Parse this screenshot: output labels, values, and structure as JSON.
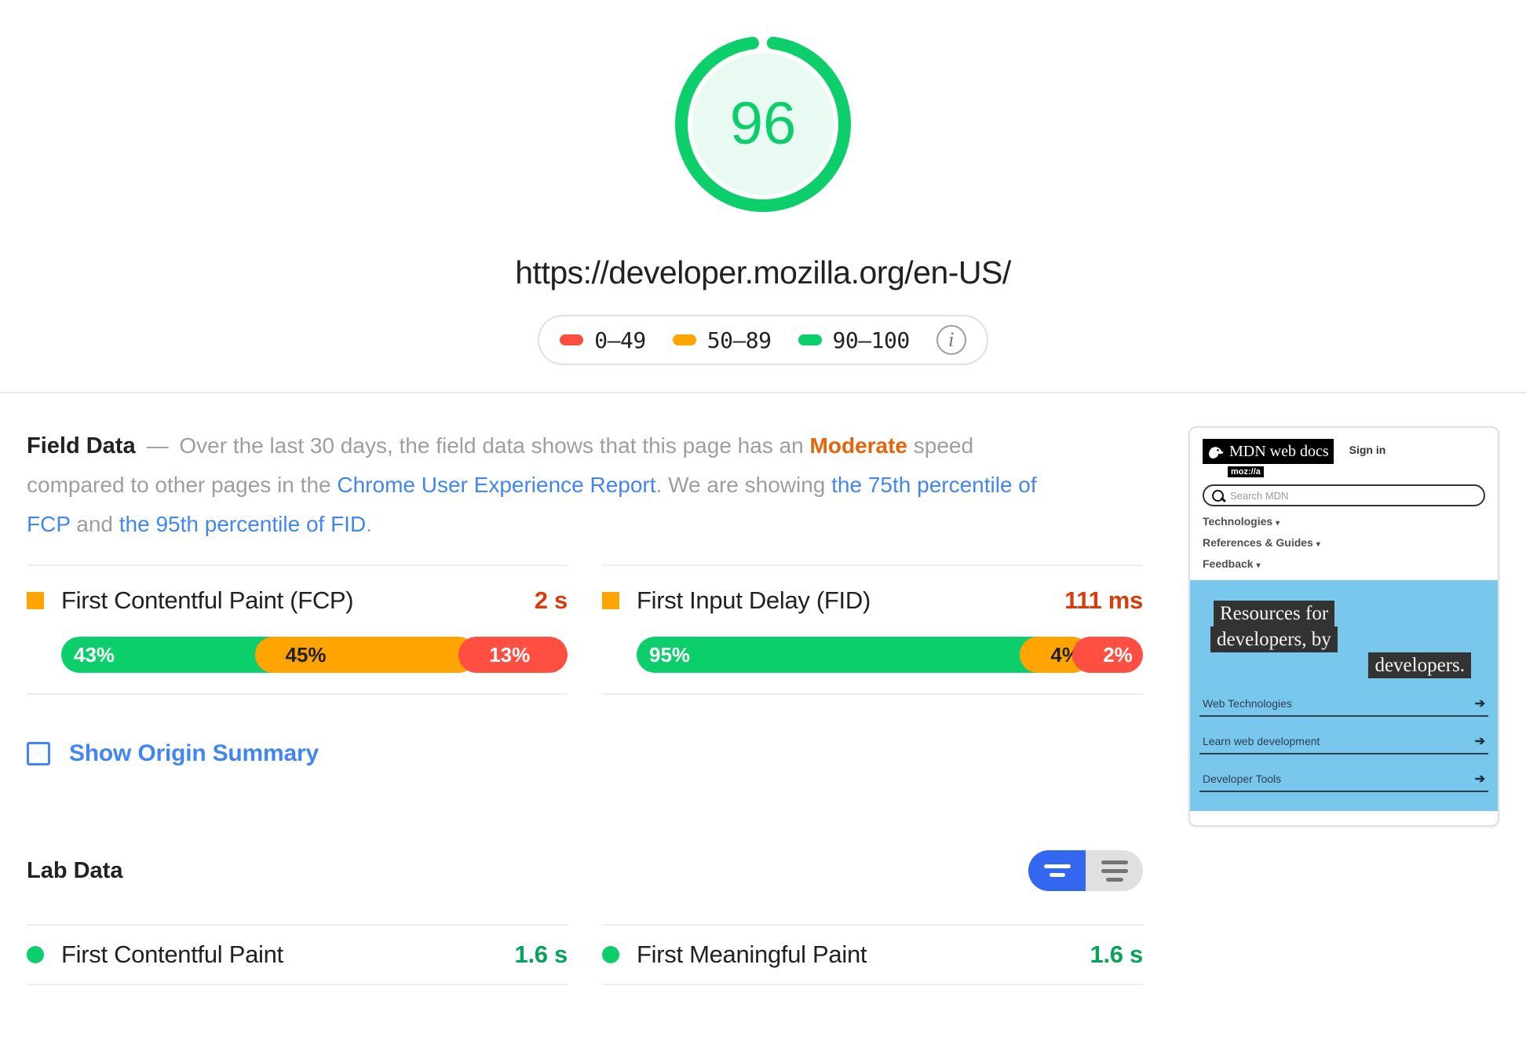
{
  "score": {
    "value": "96",
    "color": "#0cce6b",
    "url": "https://developer.mozilla.org/en-US/"
  },
  "legend": {
    "items": [
      {
        "label": "0–49",
        "color": "#ff4e42",
        "name": "poor"
      },
      {
        "label": "50–89",
        "color": "#ffa400",
        "name": "average"
      },
      {
        "label": "90–100",
        "color": "#0cce6b",
        "name": "good"
      }
    ],
    "info_icon": "i"
  },
  "field_data": {
    "title": "Field Data",
    "dash": "—",
    "text_1": "Over the last 30 days, the field data shows that this page has an ",
    "rating": "Moderate",
    "text_2": " speed compared to other pages in the ",
    "link_1": "Chrome User Experience Report",
    "text_3": ". We are showing ",
    "link_2": "the 75th percentile of FCP",
    "text_4": " and ",
    "link_3": "the 95th percentile of FID",
    "text_5": ".",
    "metrics": [
      {
        "name": "First Contentful Paint (FCP)",
        "value": "2 s",
        "value_color": "#d93b0a",
        "marker_color": "#ffa400",
        "distribution": [
          {
            "label": "43%",
            "pct": 43,
            "bucket": "good"
          },
          {
            "label": "45%",
            "pct": 45,
            "bucket": "avg"
          },
          {
            "label": "13%",
            "pct": 13,
            "bucket": "poor"
          }
        ]
      },
      {
        "name": "First Input Delay (FID)",
        "value": "111 ms",
        "value_color": "#d93b0a",
        "marker_color": "#ffa400",
        "distribution": [
          {
            "label": "95%",
            "pct": 85,
            "bucket": "good"
          },
          {
            "label": "4%",
            "pct": 9,
            "bucket": "avg"
          },
          {
            "label": "2%",
            "pct": 9,
            "bucket": "poor"
          }
        ]
      }
    ],
    "origin_summary": {
      "label": "Show Origin Summary",
      "checked": false
    }
  },
  "lab_data": {
    "title": "Lab Data",
    "toggle": {
      "active_view": "compact",
      "options": [
        "compact",
        "detailed"
      ]
    },
    "metrics": [
      {
        "name": "First Contentful Paint",
        "value": "1.6 s",
        "dot_color": "#0cce6b"
      },
      {
        "name": "First Meaningful Paint",
        "value": "1.6 s",
        "dot_color": "#0cce6b"
      }
    ]
  },
  "screenshot": {
    "brand": "MDN web docs",
    "mozilla_tag": "moz://a",
    "sign_in": "Sign in",
    "search_placeholder": "Search MDN",
    "nav": [
      {
        "label": "Technologies",
        "caret": "▾"
      },
      {
        "label": "References & Guides",
        "caret": "▾"
      },
      {
        "label": "Feedback",
        "caret": "▾"
      }
    ],
    "hero": {
      "line_1": "Resources for",
      "line_2": "developers, by",
      "line_3": "developers.",
      "bg_color": "#79c7ec"
    },
    "links": [
      {
        "label": "Web Technologies",
        "arrow": "➔"
      },
      {
        "label": "Learn web development",
        "arrow": "➔"
      },
      {
        "label": "Developer Tools",
        "arrow": "➔"
      }
    ]
  }
}
